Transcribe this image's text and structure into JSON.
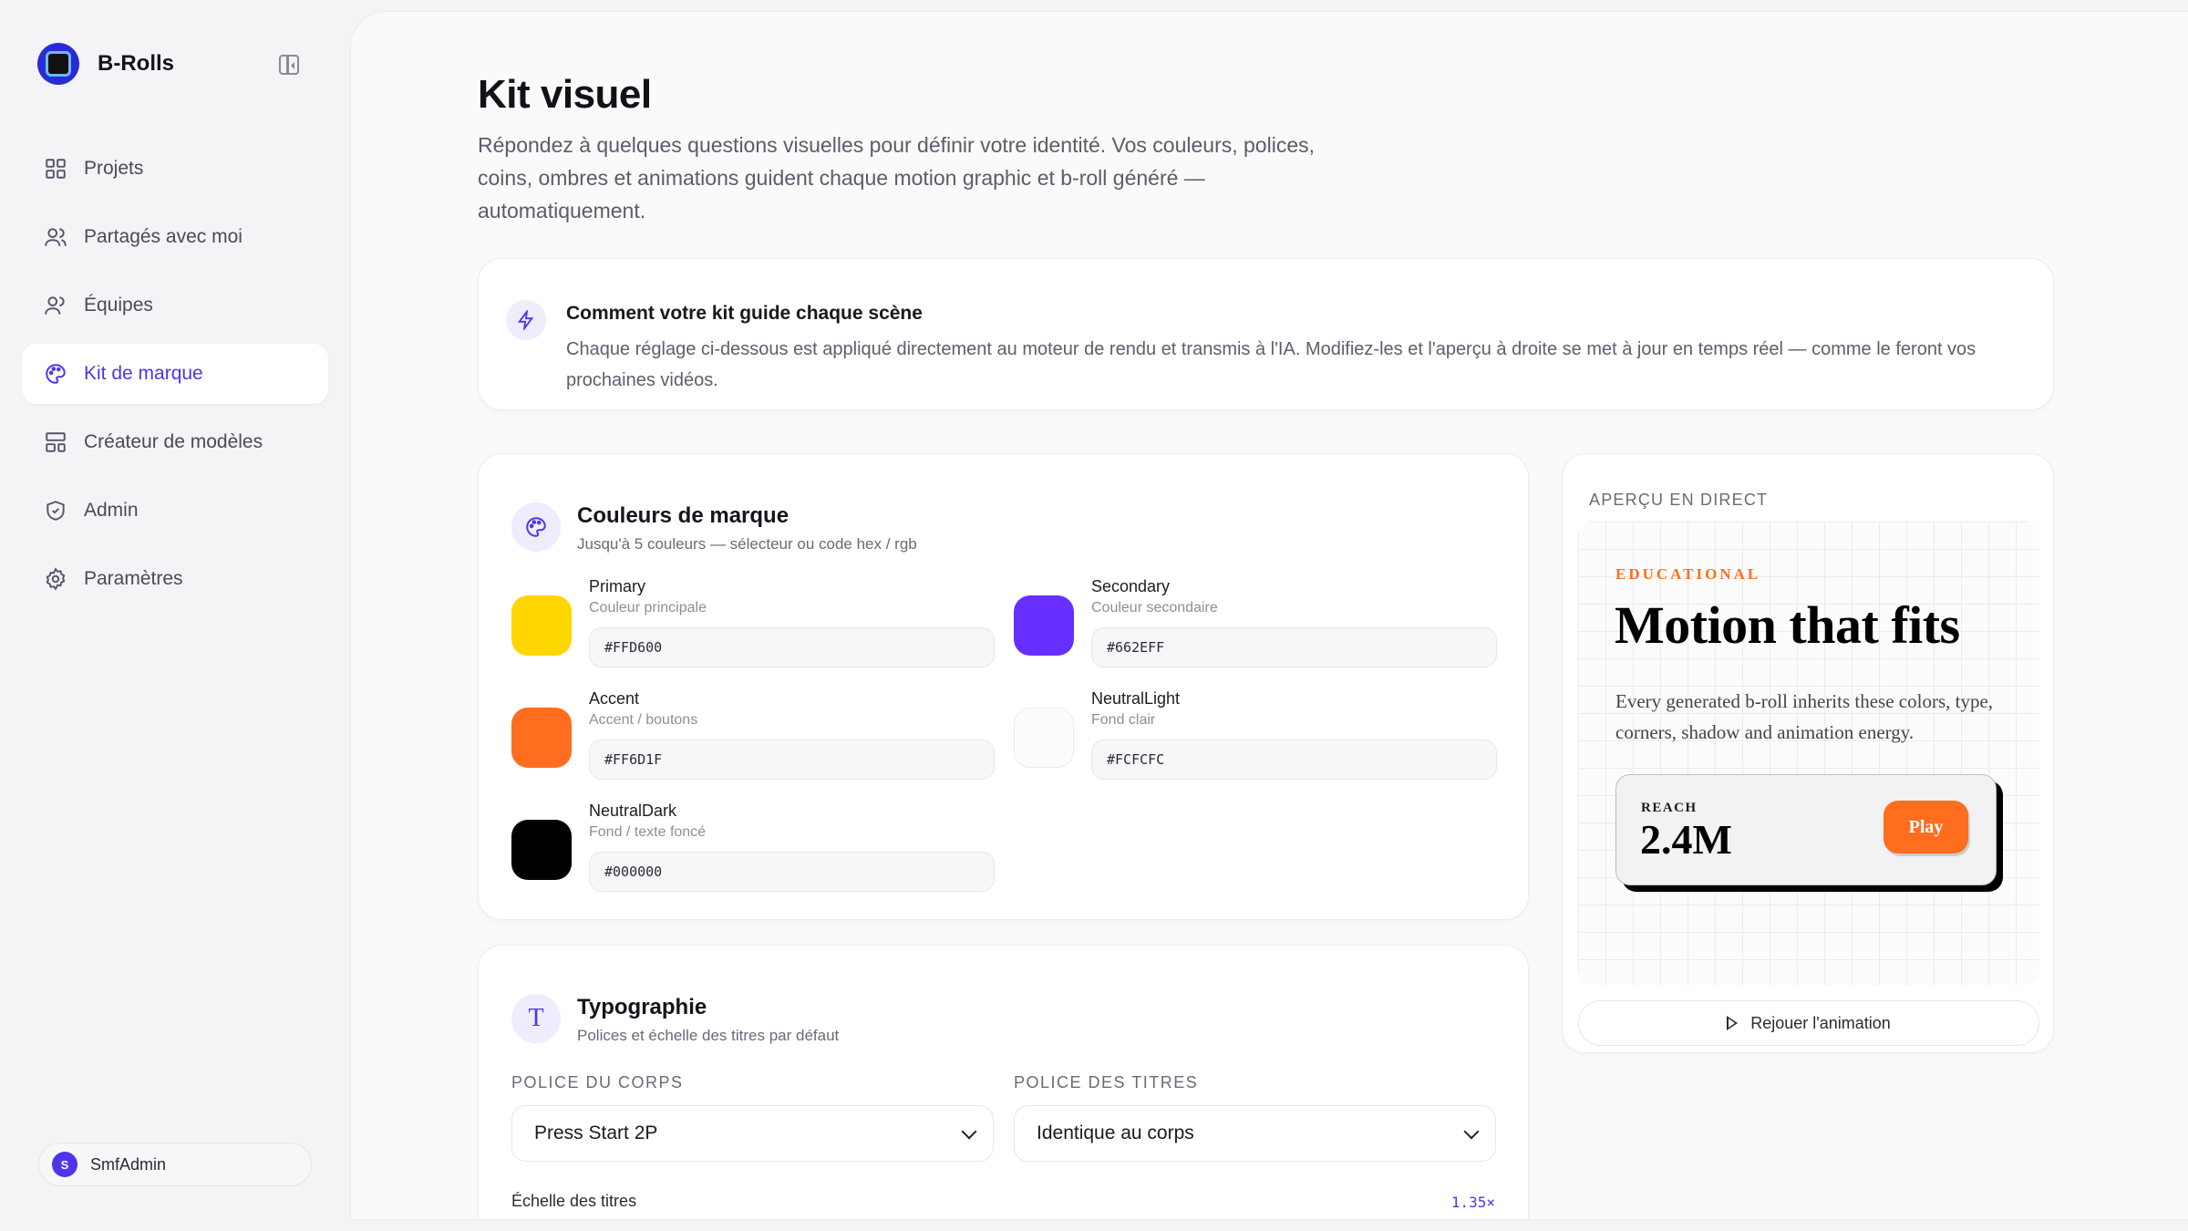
{
  "app": {
    "name": "B-Rolls"
  },
  "sidebar": {
    "items": [
      {
        "label": "Projets",
        "icon": "grid-icon",
        "active": false
      },
      {
        "label": "Partagés avec moi",
        "icon": "users-icon",
        "active": false
      },
      {
        "label": "Équipes",
        "icon": "team-icon",
        "active": false
      },
      {
        "label": "Kit de marque",
        "icon": "palette-icon",
        "active": true
      },
      {
        "label": "Créateur de modèles",
        "icon": "layout-template-icon",
        "active": false
      },
      {
        "label": "Admin",
        "icon": "shield-icon",
        "active": false
      },
      {
        "label": "Paramètres",
        "icon": "gear-icon",
        "active": false
      }
    ],
    "user": {
      "initial": "S",
      "name": "SmfAdmin"
    }
  },
  "page": {
    "title": "Kit visuel",
    "description": "Répondez à quelques questions visuelles pour définir votre identité. Vos couleurs, polices, coins, ombres et animations guident chaque motion graphic et b-roll généré — automatiquement."
  },
  "info": {
    "title": "Comment votre kit guide chaque scène",
    "text": "Chaque réglage ci-dessous est appliqué directement au moteur de rendu et transmis à l'IA. Modifiez-les et l'aperçu à droite se met à jour en temps réel — comme le feront vos prochaines vidéos."
  },
  "colors": {
    "title": "Couleurs de marque",
    "subtitle": "Jusqu'à 5 couleurs — sélecteur ou code hex / rgb",
    "swatches": [
      {
        "name": "Primary",
        "role": "Couleur principale",
        "hex": "#FFD600"
      },
      {
        "name": "Secondary",
        "role": "Couleur secondaire",
        "hex": "#662EFF"
      },
      {
        "name": "Accent",
        "role": "Accent / boutons",
        "hex": "#FF6D1F"
      },
      {
        "name": "NeutralLight",
        "role": "Fond clair",
        "hex": "#FCFCFC"
      },
      {
        "name": "NeutralDark",
        "role": "Fond / texte foncé",
        "hex": "#000000"
      }
    ]
  },
  "typography": {
    "title": "Typographie",
    "subtitle": "Polices et échelle des titres par défaut",
    "body_font_label": "POLICE DU CORPS",
    "body_font_value": "Press Start 2P",
    "heading_font_label": "POLICE DES TITRES",
    "heading_font_value": "Identique au corps",
    "scale_label": "Échelle des titres",
    "scale_value": "1.35×"
  },
  "preview": {
    "label": "APERÇU EN DIRECT",
    "eyebrow": "EDUCATIONAL",
    "headline": "Motion that fits",
    "body": "Every generated b-roll inherits these colors, type, corners, shadow and animation energy.",
    "stat_label": "REACH",
    "stat_value": "2.4M",
    "play_label": "Play",
    "replay_label": "Rejouer l'animation"
  },
  "theme": {
    "accent": "#4F35E8"
  }
}
